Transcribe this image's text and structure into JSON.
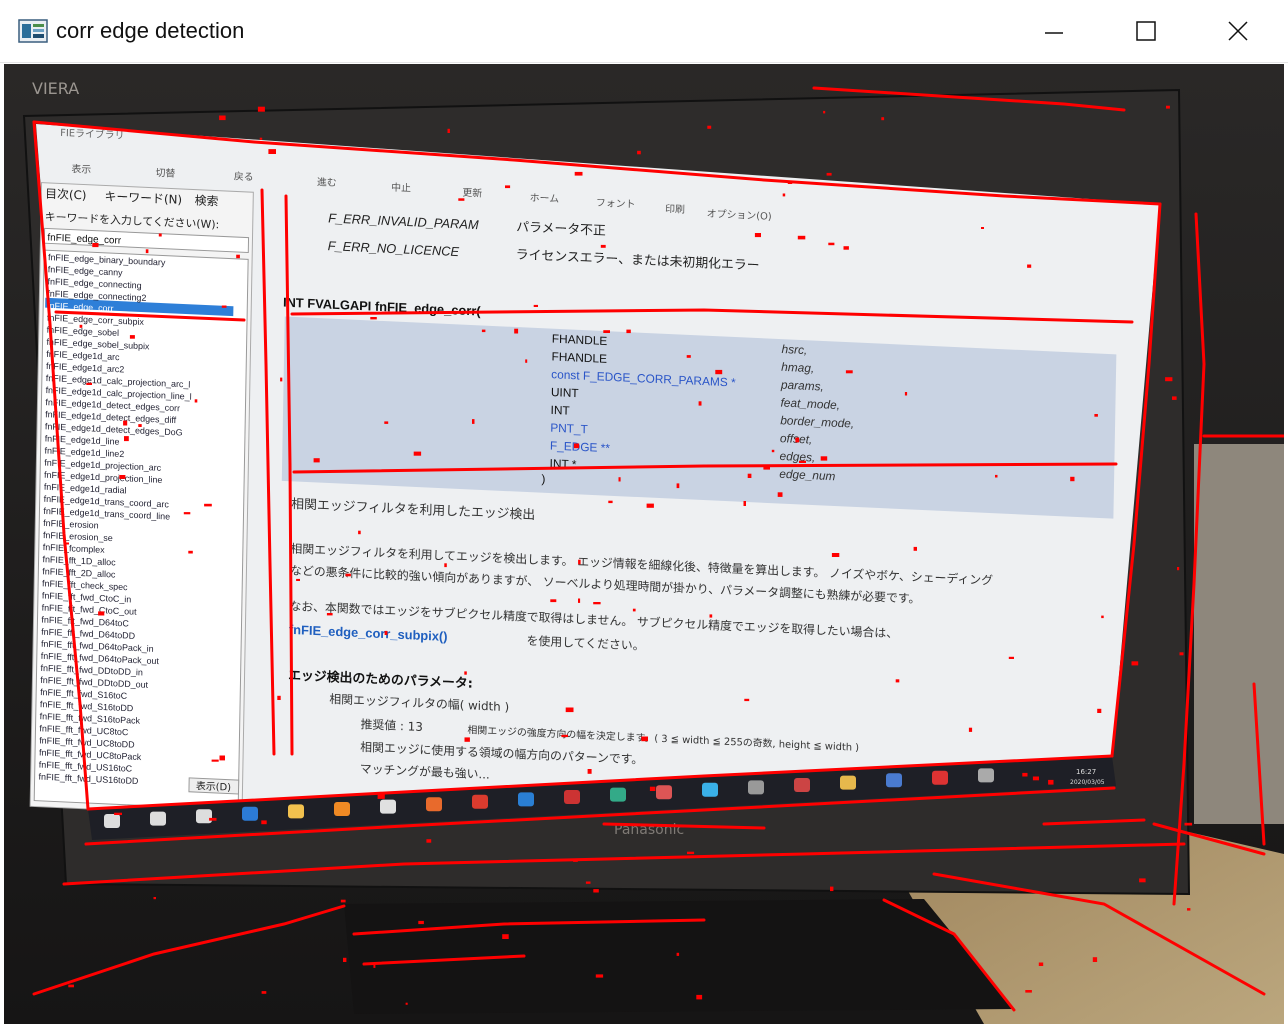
{
  "window": {
    "title": "corr edge detection",
    "icon": "app-window-icon",
    "controls": [
      "minimize-icon",
      "maximize-icon",
      "close-icon"
    ]
  },
  "photo": {
    "monitor_brand": "VIERA",
    "helpviewer": {
      "title": "FIEライブラリ",
      "toolbar": [
        "表示",
        "切替",
        "戻る",
        "進む",
        "中止",
        "更新",
        "ホーム",
        "フォント",
        "印刷",
        "オプション(O)"
      ],
      "tabs": [
        "目次(C)",
        "キーワード(N)",
        "検索"
      ],
      "keyword_prompt": "キーワードを入力してください(W):",
      "keyword_value": "fnFIE_edge_corr",
      "keyword_list": [
        "fnFIE_edge_binary_boundary",
        "fnFIE_edge_canny",
        "fnFIE_edge_connecting",
        "fnFIE_edge_connecting2",
        "fnFIE_edge_corr",
        "fnFIE_edge_corr_subpix",
        "fnFIE_edge_sobel",
        "fnFIE_edge_sobel_subpix",
        "fnFIE_edge1d_arc",
        "fnFIE_edge1d_arc2",
        "fnFIE_edge1d_calc_projection_arc_l",
        "fnFIE_edge1d_calc_projection_line_l",
        "fnFIE_edge1d_detect_edges_corr",
        "fnFIE_edge1d_detect_edges_diff",
        "fnFIE_edge1d_detect_edges_DoG",
        "fnFIE_edge1d_line",
        "fnFIE_edge1d_line2",
        "fnFIE_edge1d_projection_arc",
        "fnFIE_edge1d_projection_line",
        "fnFIE_edge1d_radial",
        "fnFIE_edge1d_trans_coord_arc",
        "fnFIE_edge1d_trans_coord_line",
        "fnFIE_erosion",
        "fnFIE_erosion_se",
        "fnFIE_fcomplex",
        "fnFIE_fft_1D_alloc",
        "fnFIE_fft_2D_alloc",
        "fnFIE_fft_check_spec",
        "fnFIE_fft_fwd_CtoC_in",
        "fnFIE_fft_fwd_CtoC_out",
        "fnFIE_fft_fwd_D64toC",
        "fnFIE_fft_fwd_D64toDD",
        "fnFIE_fft_fwd_D64toPack_in",
        "fnFIE_fft_fwd_D64toPack_out",
        "fnFIE_fft_fwd_DDtoDD_in",
        "fnFIE_fft_fwd_DDtoDD_out",
        "fnFIE_fft_fwd_S16toC",
        "fnFIE_fft_fwd_S16toDD",
        "fnFIE_fft_fwd_S16toPack",
        "fnFIE_fft_fwd_UC8toC",
        "fnFIE_fft_fwd_UC8toDD",
        "fnFIE_fft_fwd_UC8toPack",
        "fnFIE_fft_fwd_US16toC",
        "fnFIE_fft_fwd_US16toDD"
      ],
      "selected_index": 4,
      "display_button": "表示(D)",
      "errors": [
        {
          "code": "F_ERR_INVALID_PARAM",
          "text": "パラメータ不正"
        },
        {
          "code": "F_ERR_NO_LICENCE",
          "text": "ライセンスエラー、または未初期化エラー"
        }
      ],
      "signature": {
        "head": "INT FVALGAPI fnFIE_edge_corr(",
        "params": [
          {
            "type": "FHANDLE",
            "name": "hsrc,",
            "link": false
          },
          {
            "type": "FHANDLE",
            "name": "hmag,",
            "link": false
          },
          {
            "type": "const F_EDGE_CORR_PARAMS *",
            "name": "params,",
            "link": true
          },
          {
            "type": "UINT",
            "name": "feat_mode,",
            "link": false
          },
          {
            "type": "INT",
            "name": "border_mode,",
            "link": false
          },
          {
            "type": "PNT_T",
            "name": "offset,",
            "link": true
          },
          {
            "type": "F_EDGE **",
            "name": "edges,",
            "link": true
          },
          {
            "type": "INT *",
            "name": "edge_num",
            "link": false
          }
        ],
        "close": ")"
      },
      "summary": "相関エッジフィルタを利用したエッジ検出",
      "desc1": "相関エッジフィルタを利用してエッジを検出します。 エッジ情報を細線化後、特徴量を算出します。 ノイズやボケ、シェーディング",
      "desc2": "などの悪条件に比較的強い傾向がありますが、 ソーベルより処理時間が掛かり、パラメータ調整にも熟練が必要です。",
      "desc3": "なお、本関数ではエッジをサブピクセル精度で取得はしません。 サブピクセル精度でエッジを取得したい場合は、",
      "link_fn": "fnFIE_edge_corr_subpix()",
      "link_suffix": " を使用してください。",
      "params_heading": "エッジ検出のためのパラメータ:",
      "param_width": "相関エッジフィルタの幅( width )",
      "bullet1": "推奨値 : 13",
      "bullet1b": "相関エッジの強度方向の幅を決定します。( 3 ≦ width ≦ 255の奇数, height ≦ width )",
      "bullet2": "相関エッジに使用する領域の幅方向のパターンです。",
      "bullet3": "マッチングが最も強い..."
    },
    "taskbar": {
      "clock_time": "16:27",
      "clock_date": "2020/03/05",
      "icons": [
        "start-icon",
        "search-icon",
        "task-view-icon",
        "edge-browser-icon",
        "file-explorer-icon",
        "magnifier-icon",
        "app-icon",
        "app-icon",
        "chrome-icon",
        "vscode-icon",
        "app-icon",
        "app-icon",
        "app-icon",
        "ie-icon",
        "app-icon",
        "app-icon",
        "app-icon",
        "app-icon",
        "app-icon",
        "app-icon"
      ]
    },
    "monitor_brand_bottom": "Panasonic",
    "edge_color": "#ff0000"
  }
}
